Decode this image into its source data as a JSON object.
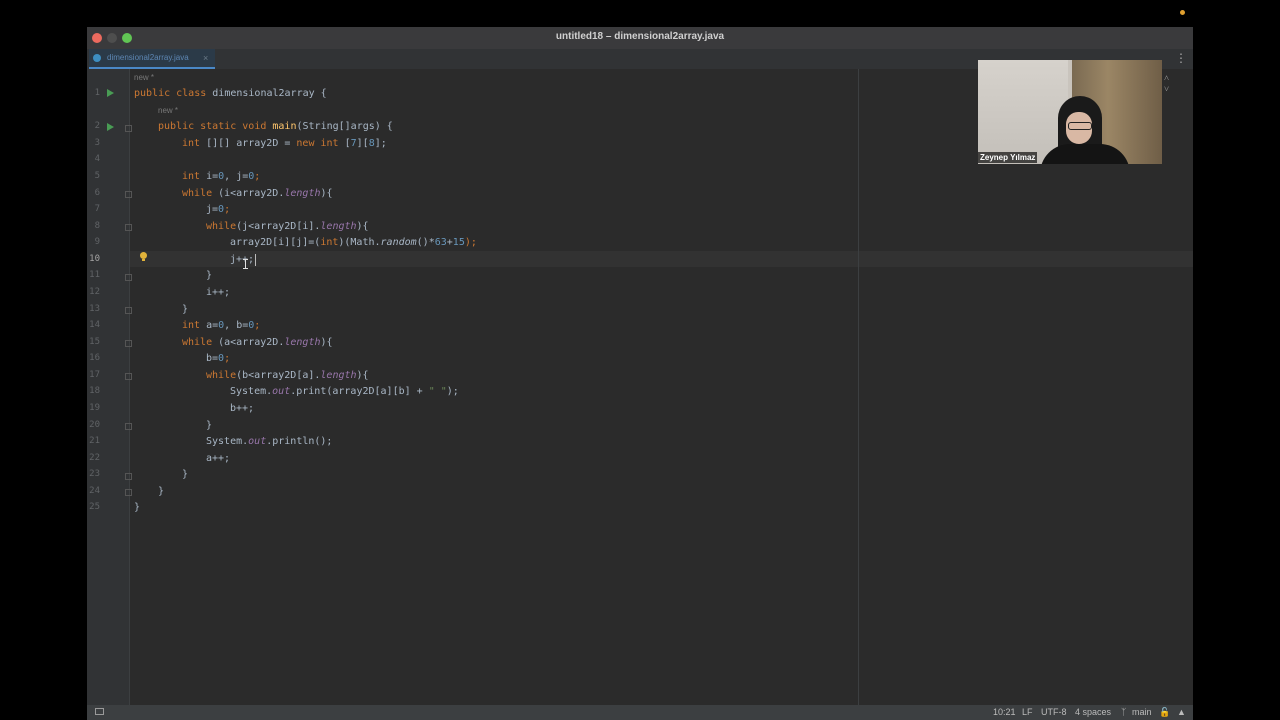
{
  "window": {
    "title": "untitled18 – dimensional2array.java"
  },
  "tab": {
    "label": "dimensional2array.java",
    "close": "×"
  },
  "editor": {
    "hint_new": "new *",
    "line_numbers": [
      "1",
      "2",
      "3",
      "4",
      "5",
      "6",
      "7",
      "8",
      "9",
      "10",
      "11",
      "12",
      "13",
      "14",
      "15",
      "16",
      "17",
      "18",
      "19",
      "20",
      "21",
      "22",
      "23",
      "24",
      "25"
    ],
    "current_line": "10",
    "nav_arrows": "˄ ˅"
  },
  "code": {
    "l1": [
      "public class ",
      "dimensional2array {"
    ],
    "l2": [
      "public static void ",
      "main",
      "(String[]args) {"
    ],
    "l3": [
      "int ",
      "[][] array2D = ",
      "new int ",
      "[",
      "7",
      "][",
      "8",
      "];"
    ],
    "l5": [
      "int ",
      "i=",
      "0",
      ", j=",
      "0",
      ";"
    ],
    "l6": [
      "while ",
      "(i<array2D.",
      "length",
      "){"
    ],
    "l7": [
      "j=",
      "0",
      ";"
    ],
    "l8": [
      "while",
      "(j<array2D[i].",
      "length",
      "){"
    ],
    "l9": [
      "array2D[i][j]=(",
      "int",
      ")(Math.",
      "random",
      "()*",
      "63",
      "+",
      "15",
      ");"
    ],
    "l10": [
      "j++;"
    ],
    "l11": [
      "}"
    ],
    "l12": [
      "i++;"
    ],
    "l13": [
      "}"
    ],
    "l14": [
      "int ",
      "a=",
      "0",
      ", b=",
      "0",
      ";"
    ],
    "l15": [
      "while ",
      "(a<array2D.",
      "length",
      "){"
    ],
    "l16": [
      "b=",
      "0",
      ";"
    ],
    "l17": [
      "while",
      "(b<array2D[a].",
      "length",
      "){"
    ],
    "l18": [
      "System.",
      "out",
      ".print(array2D[a][b] + ",
      "\" \"",
      ");"
    ],
    "l19": [
      "b++;"
    ],
    "l20": [
      "}"
    ],
    "l21": [
      "System.",
      "out",
      ".println();"
    ],
    "l22": [
      "a++;"
    ],
    "l23": [
      "}"
    ],
    "l24": [
      "}"
    ],
    "l25": [
      "}"
    ]
  },
  "status": {
    "position": "10:21",
    "line_sep": "LF",
    "encoding": "UTF-8",
    "indent": "4 spaces",
    "branch": "main"
  },
  "video": {
    "name": "Zeynep Yılmaz"
  },
  "colors": {
    "keyword": "#cc7832",
    "function": "#ffc66d",
    "number": "#6897bb",
    "field": "#9876aa",
    "string": "#6a8759",
    "text": "#a9b7c6"
  }
}
